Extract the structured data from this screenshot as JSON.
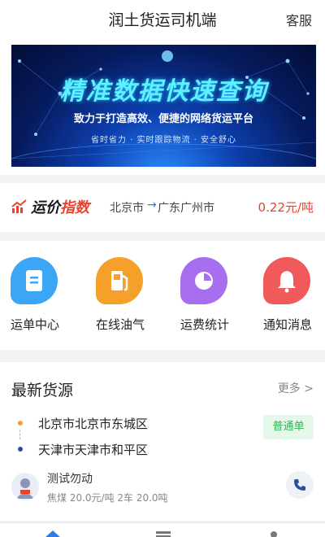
{
  "header": {
    "title": "润土货运司机端",
    "service_label": "客服"
  },
  "banner": {
    "title": "精准数据快速查询",
    "subtitle": "致力于打造高效、便捷的网络货运平台",
    "slogan": "省时省力 · 实时跟踪物流 · 安全舒心"
  },
  "price_index": {
    "label_a": "运价",
    "label_b": "指数",
    "from": "北京市",
    "arrow": "→",
    "to": "广东广州市",
    "price": "0.22元/吨"
  },
  "menu": {
    "items": [
      {
        "label": "运单中心",
        "icon": "waybill-icon",
        "color": "#3aa6f5"
      },
      {
        "label": "在线油气",
        "icon": "fuel-pump-icon",
        "color": "#f5a02a"
      },
      {
        "label": "运费统计",
        "icon": "pie-chart-icon",
        "color": "#a86ef0"
      },
      {
        "label": "通知消息",
        "icon": "bell-icon",
        "color": "#f05a5a"
      }
    ]
  },
  "latest": {
    "title": "最新货源",
    "more_label": "更多 >",
    "cargo": {
      "from": "北京市北京市东城区",
      "to": "天津市天津市和平区",
      "type": "普通单",
      "poster": "测试勿动",
      "info": "焦煤 20.0元/吨 2车 20.0吨"
    }
  },
  "colors": {
    "accent_red": "#e8432d",
    "accent_blue": "#2d7be8",
    "badge_green": "#2fb552",
    "dot_orange": "#f5a02a",
    "dot_blue": "#2d4f9e"
  }
}
